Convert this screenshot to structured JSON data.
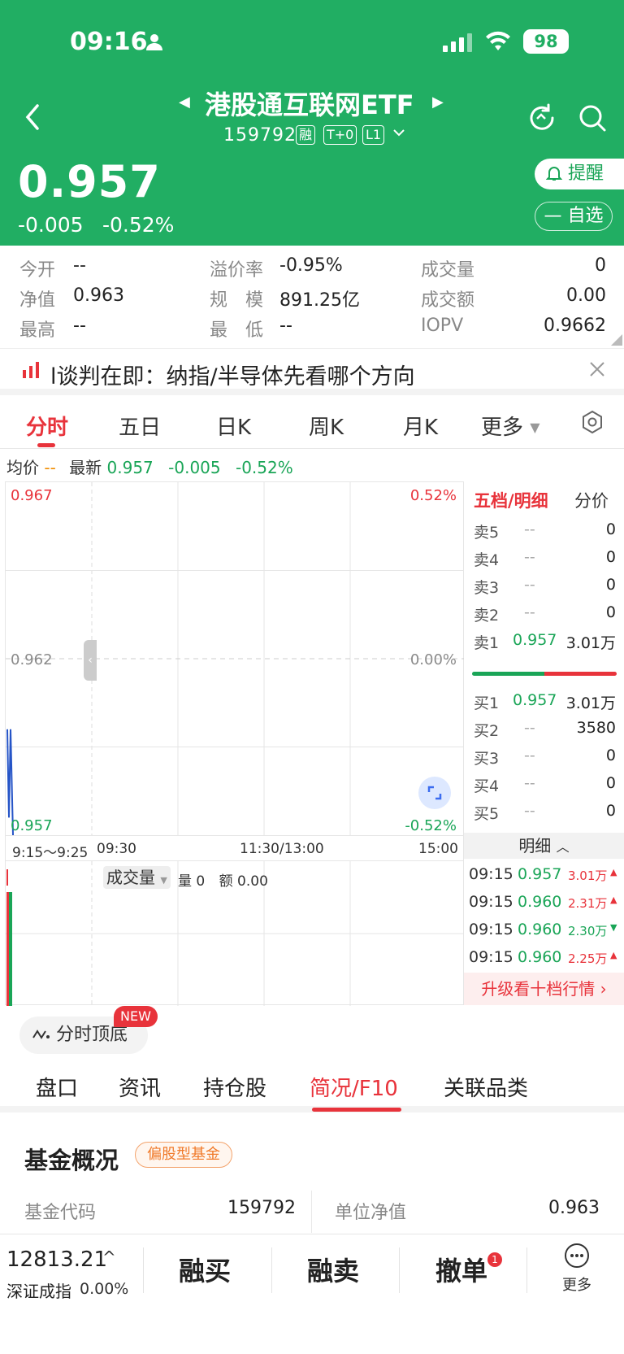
{
  "status_bar": {
    "time": "09:16",
    "battery": "98"
  },
  "header": {
    "title": "港股通互联网ETF",
    "code": "159792",
    "tags": [
      "融",
      "T+0",
      "L1"
    ],
    "price": "0.957",
    "change": "-0.005",
    "change_pct": "-0.52%",
    "remind_label": "提醒",
    "watch_label": "自选"
  },
  "stats": {
    "open_label": "今开",
    "open_value": "--",
    "nav_label": "净值",
    "nav_value": "0.963",
    "high_label": "最高",
    "high_value": "--",
    "premium_label": "溢价率",
    "premium_value": "-0.95%",
    "scale_label": "规　模",
    "scale_value": "891.25亿",
    "low_label": "最　低",
    "low_value": "--",
    "volume_label": "成交量",
    "volume_value": "0",
    "amount_label": "成交额",
    "amount_value": "0.00",
    "iopv_label": "IOPV",
    "iopv_value": "0.9662"
  },
  "news": {
    "text": "l谈判在即：纳指/半导体先看哪个方向"
  },
  "chart_tabs": [
    "分时",
    "五日",
    "日K",
    "周K",
    "月K",
    "更多"
  ],
  "avg_bar": {
    "avg_label": "均价",
    "avg_value": "--",
    "latest_label": "最新",
    "latest_value": "0.957",
    "change": "-0.005",
    "change_pct": "-0.52%"
  },
  "chart": {
    "y_top": "0.967",
    "y_mid": "0.962",
    "y_bottom": "0.957",
    "pct_top": "0.52%",
    "pct_mid": "0.00%",
    "pct_bottom": "-0.52%",
    "x_labels": [
      "9:15～9:25",
      "09:30",
      "11:30/13:00",
      "15:00"
    ],
    "volume_label": "成交量",
    "vol_qty_label": "量",
    "vol_qty_value": "0",
    "vol_amt_label": "额",
    "vol_amt_value": "0.00"
  },
  "chart_data": {
    "type": "line",
    "x": [
      "09:15",
      "09:16"
    ],
    "series": [
      {
        "values": [
          0.96,
          0.957
        ]
      }
    ],
    "ylim": [
      0.957,
      0.967
    ]
  },
  "orderbook": {
    "tab_active": "五档/明细",
    "tab_other": "分价",
    "asks": [
      {
        "label": "卖5",
        "price": "--",
        "qty": "0"
      },
      {
        "label": "卖4",
        "price": "--",
        "qty": "0"
      },
      {
        "label": "卖3",
        "price": "--",
        "qty": "0"
      },
      {
        "label": "卖2",
        "price": "--",
        "qty": "0"
      },
      {
        "label": "卖1",
        "price": "0.957",
        "qty": "3.01万"
      }
    ],
    "bids": [
      {
        "label": "买1",
        "price": "0.957",
        "qty": "3.01万"
      },
      {
        "label": "买2",
        "price": "--",
        "qty": "3580"
      },
      {
        "label": "买3",
        "price": "--",
        "qty": "0"
      },
      {
        "label": "买4",
        "price": "--",
        "qty": "0"
      },
      {
        "label": "买5",
        "price": "--",
        "qty": "0"
      }
    ],
    "detail_label": "明细",
    "details": [
      {
        "time": "09:15",
        "price": "0.957",
        "qty": "3.01万",
        "dir": "up"
      },
      {
        "time": "09:15",
        "price": "0.960",
        "qty": "2.31万",
        "dir": "up"
      },
      {
        "time": "09:15",
        "price": "0.960",
        "qty": "2.30万",
        "dir": "down"
      },
      {
        "time": "09:15",
        "price": "0.960",
        "qty": "2.25万",
        "dir": "up"
      }
    ],
    "upgrade_label": "升级看十档行情"
  },
  "pill": {
    "label": "分时顶底",
    "badge": "NEW"
  },
  "sub_tabs": [
    "盘口",
    "资讯",
    "持仓股",
    "简况/F10",
    "关联品类"
  ],
  "fund": {
    "title": "基金概况",
    "tag": "偏股型基金",
    "code_label": "基金代码",
    "code_value": "159792",
    "nav_label": "单位净值",
    "nav_value": "0.963"
  },
  "bottom_bar": {
    "index_value": "12813.21",
    "index_name": "深证成指",
    "index_change": "0.00%",
    "buy_label": "融买",
    "sell_label": "融卖",
    "cancel_label": "撤单",
    "cancel_badge": "1",
    "more_label": "更多"
  },
  "colors": {
    "brand_green": "#21ae63",
    "up_red": "#e8333b",
    "down_green": "#1aa557"
  }
}
